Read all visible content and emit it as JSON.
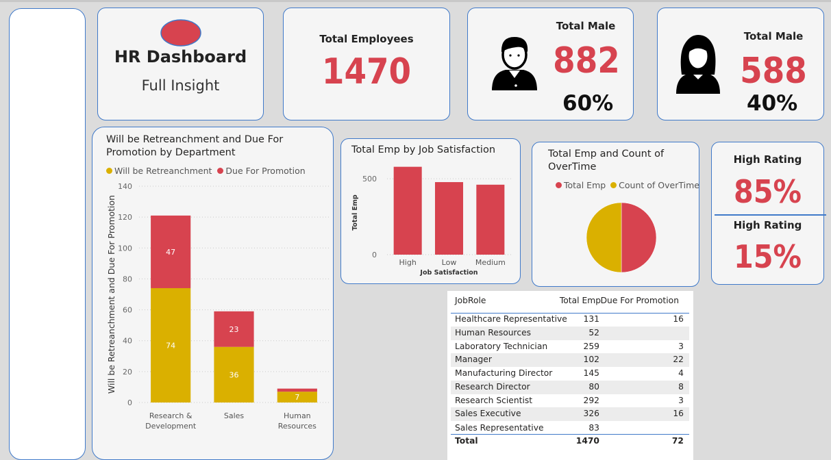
{
  "header": {
    "title": "HR Dashboard",
    "subtitle": "Full Insight"
  },
  "kpis": {
    "total_employees": {
      "label": "Total Employees",
      "value": "1470"
    },
    "male": {
      "label": "Total Male",
      "value": "882",
      "percent": "60%"
    },
    "female": {
      "label": "Total Male",
      "value": "588",
      "percent": "40%"
    },
    "rating_high": {
      "label": "High Rating",
      "value": "85%"
    },
    "rating_low": {
      "label": "High Rating",
      "value": "15%"
    }
  },
  "colors": {
    "red": "#d7434f",
    "gold": "#dab000",
    "border": "#3f79c9"
  },
  "icons": {
    "male": "male-person-icon",
    "female": "female-person-icon",
    "logo": "red-oval-logo-icon"
  },
  "chart_data": [
    {
      "type": "bar",
      "stacked": true,
      "title": "Will be Retreanchment and Due For Promotion by Department",
      "ylabel": "Will be Retreanchment and Due For Promotion",
      "xlabel": "",
      "ylim": [
        0,
        140
      ],
      "yticks": [
        "0",
        "20",
        "40",
        "60",
        "80",
        "100",
        "120",
        "140"
      ],
      "grid": true,
      "legend_position": "top-left",
      "categories": [
        "Research & Development",
        "Sales",
        "Human Resources"
      ],
      "series": [
        {
          "name": "Will be Retreanchment",
          "color": "#dab000",
          "values": [
            74,
            36,
            7
          ],
          "labels": [
            "74",
            "36",
            "7"
          ]
        },
        {
          "name": "Due For Promotion",
          "color": "#d7434f",
          "values": [
            47,
            23,
            2
          ],
          "labels": [
            "47",
            "23",
            ""
          ]
        }
      ]
    },
    {
      "type": "bar",
      "title": "Total Emp by Job Satisfaction",
      "xlabel": "Job Satisfaction",
      "ylabel": "Total Emp",
      "ylim": [
        0,
        600
      ],
      "yticks": [
        "0",
        "500"
      ],
      "grid": true,
      "categories": [
        "High",
        "Low",
        "Medium"
      ],
      "values": [
        579,
        478,
        461
      ],
      "color": "#d7434f"
    },
    {
      "type": "pie",
      "title": "Total Emp and Count of OverTime",
      "legend_position": "top",
      "slices": [
        {
          "name": "Total Emp",
          "value": 50,
          "color": "#d7434f"
        },
        {
          "name": "Count of OverTime",
          "value": 50,
          "color": "#dab000"
        }
      ]
    },
    {
      "type": "table",
      "columns": [
        "JobRole",
        "Total Emp",
        "Due For Promotion"
      ],
      "rows": [
        [
          "Healthcare Representative",
          "131",
          "16"
        ],
        [
          "Human Resources",
          "52",
          ""
        ],
        [
          "Laboratory Technician",
          "259",
          "3"
        ],
        [
          "Manager",
          "102",
          "22"
        ],
        [
          "Manufacturing Director",
          "145",
          "4"
        ],
        [
          "Research Director",
          "80",
          "8"
        ],
        [
          "Research Scientist",
          "292",
          "3"
        ],
        [
          "Sales Executive",
          "326",
          "16"
        ],
        [
          "Sales Representative",
          "83",
          ""
        ]
      ],
      "total": [
        "Total",
        "1470",
        "72"
      ]
    }
  ]
}
